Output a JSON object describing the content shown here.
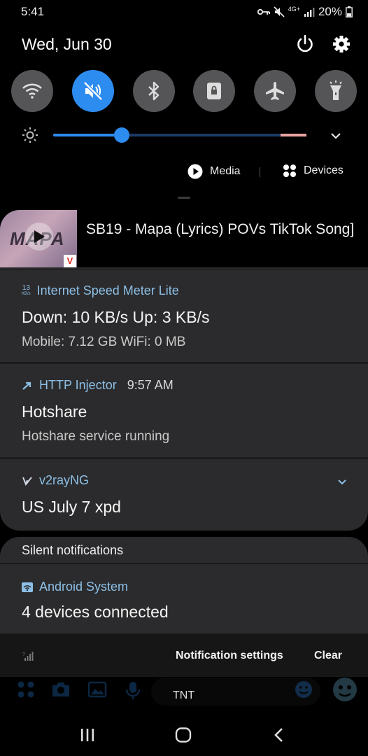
{
  "status_bar": {
    "time": "5:41",
    "network": "4G+",
    "battery": "20%"
  },
  "header": {
    "date": "Wed, Jun 30"
  },
  "quick_settings": [
    {
      "name": "wifi",
      "active": false
    },
    {
      "name": "sound-mute",
      "active": true
    },
    {
      "name": "bluetooth",
      "active": false
    },
    {
      "name": "screen-lock",
      "active": false
    },
    {
      "name": "airplane",
      "active": false
    },
    {
      "name": "flashlight",
      "active": false
    }
  ],
  "brightness": {
    "level": 0.27
  },
  "media_output": {
    "media_label": "Media",
    "devices_label": "Devices"
  },
  "notifications": {
    "media": {
      "thumb_text": "MAPA",
      "badge": "V",
      "title": "SB19 - Mapa (Lyrics)  POVs TikTok Song]"
    },
    "speed_meter": {
      "app": "Internet Speed Meter Lite",
      "icon_top": "13",
      "icon_bottom": "KB/s",
      "title": "Down: 10 KB/s   Up: 3 KB/s",
      "text": "Mobile: 7.12 GB   WiFi: 0 MB"
    },
    "http_injector": {
      "app": "HTTP Injector",
      "time": "9:57 AM",
      "title": "Hotshare",
      "text": "Hotshare service running"
    },
    "v2ray": {
      "app": "v2rayNG",
      "title": "US July 7 xpd"
    }
  },
  "silent": {
    "label": "Silent notifications",
    "android_system": {
      "app": "Android System",
      "title": "4 devices connected"
    }
  },
  "footer": {
    "notification_settings": "Notification settings",
    "clear": "Clear",
    "carrier": "TNT"
  },
  "colors": {
    "accent": "#2d8cf0",
    "app_name": "#8dbfe6",
    "card_bg": "#2b2b2d"
  }
}
